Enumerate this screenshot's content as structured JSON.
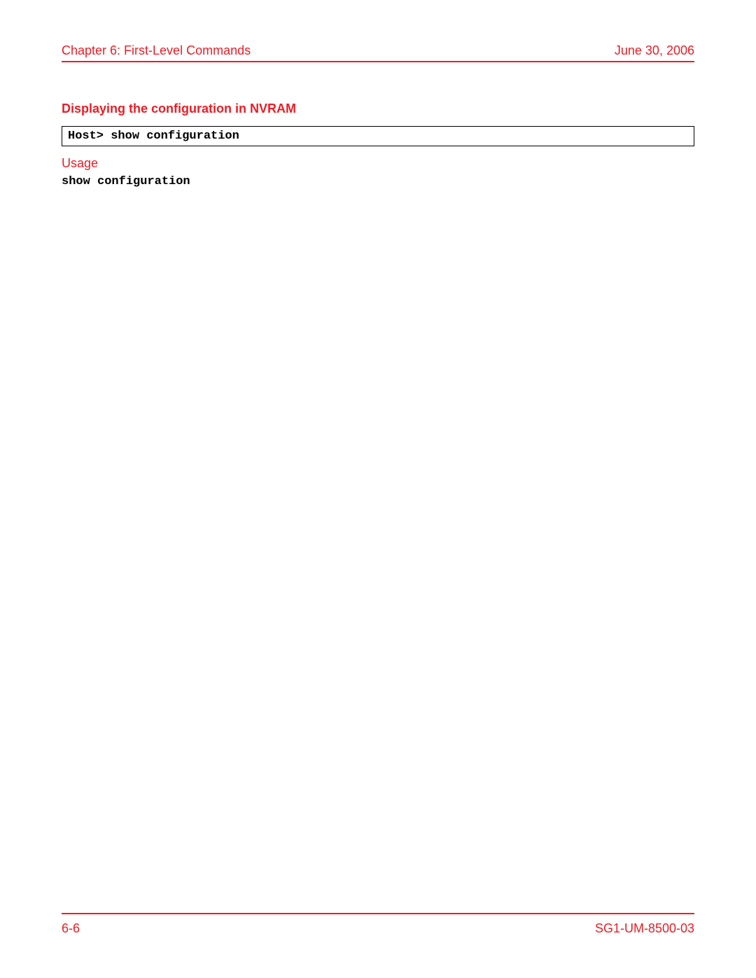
{
  "header": {
    "chapter": "Chapter 6: First-Level Commands",
    "date": "June 30, 2006"
  },
  "section": {
    "title": "Displaying the configuration in NVRAM",
    "command_box": "Host> show configuration",
    "usage_label": "Usage",
    "usage_command": "show configuration"
  },
  "footer": {
    "page_number": "6-6",
    "doc_id": "SG1-UM-8500-03"
  }
}
